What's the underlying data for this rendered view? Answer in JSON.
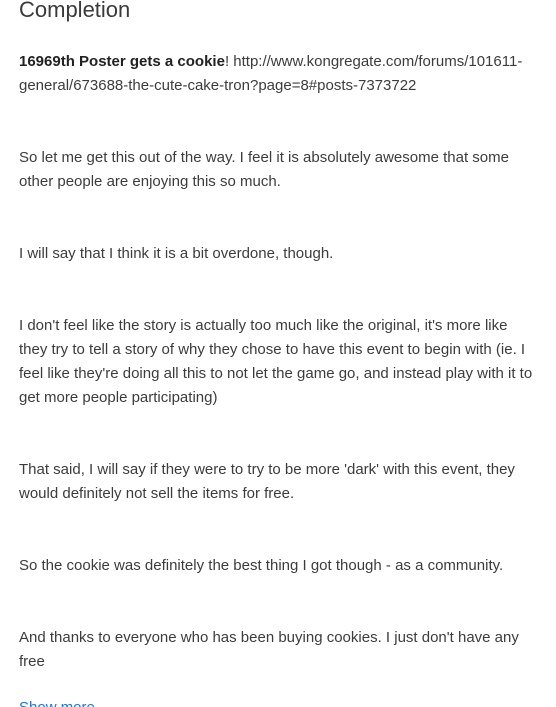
{
  "post": {
    "title": "Completion",
    "intro_bold": "16969th Poster gets a cookie",
    "intro_line1_rest": "! http://www.kongregate.com/forums/101611-",
    "intro_line2": "general/673688-the-cute-cake-tron?page=8#posts-7373722",
    "paragraphs": [
      {
        "lines": [
          "So let me get this out of the way. I feel it is absolutely awesome that some",
          "other people are enjoying this so much."
        ]
      },
      {
        "lines": [
          "I will say that I think it is a bit overdone, though."
        ]
      },
      {
        "lines": [
          "I don't feel like the story is actually too much like the original, it's more like",
          "they try to tell a story of why they chose to have this event to begin with (ie. I",
          "feel like they're doing all this to not let the game go, and instead play with it to",
          "get more people participating)"
        ]
      },
      {
        "lines": [
          "That said, I will say if they were to try to be more 'dark' with this event, they",
          "would definitely not sell the items for free."
        ]
      },
      {
        "lines": [
          "So the cookie was definitely the best thing I got though - as a community."
        ]
      },
      {
        "lines": [
          "And thanks to everyone who has been buying cookies. I just don't have any",
          "free"
        ]
      }
    ],
    "show_more_label": "Show more"
  },
  "colors": {
    "text": "#3c3c3c",
    "bold_text": "#222222",
    "link": "#1a73e8",
    "background": "#ffffff"
  }
}
